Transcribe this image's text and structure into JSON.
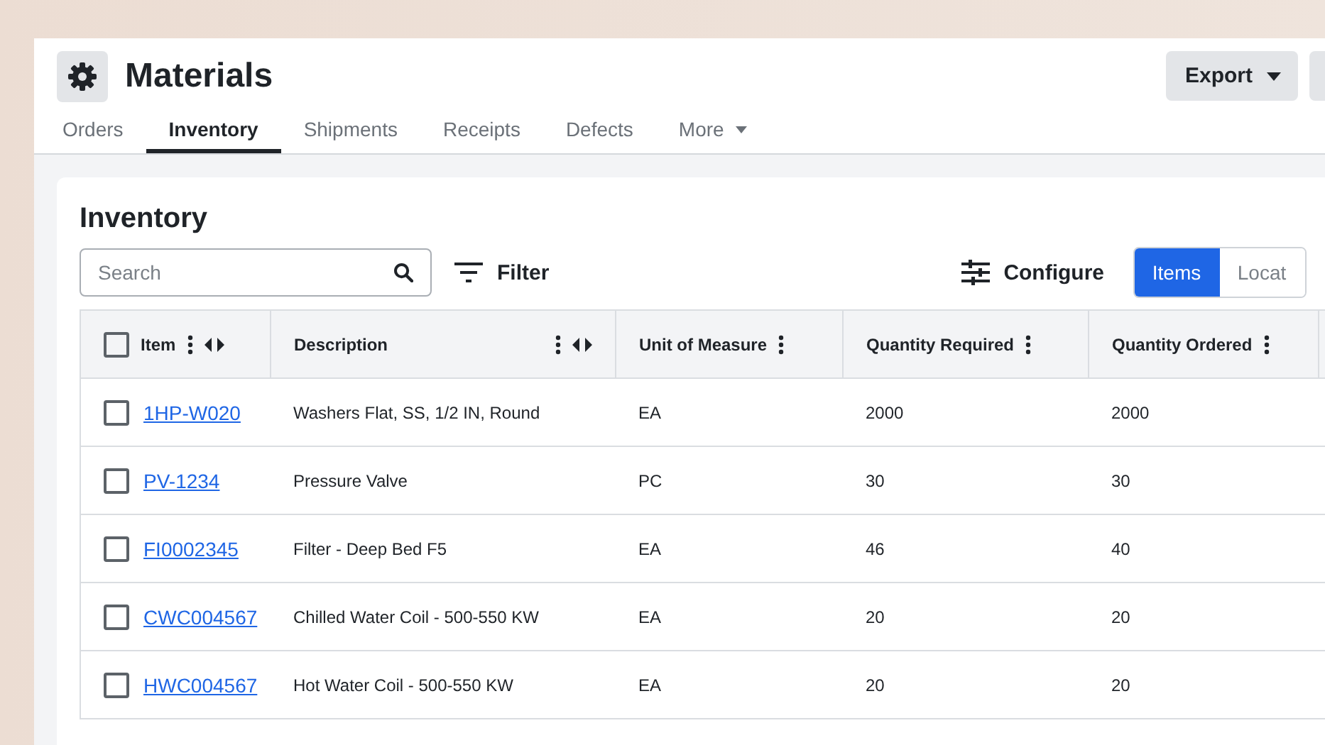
{
  "page": {
    "title": "Materials"
  },
  "header_buttons": [
    {
      "label": "Export",
      "kind": "dropdown"
    },
    {
      "kind": "cut"
    }
  ],
  "tabs": [
    {
      "label": "Orders",
      "selected": false,
      "kind": "tab"
    },
    {
      "label": "Inventory",
      "selected": true,
      "kind": "tab"
    },
    {
      "label": "Shipments",
      "selected": false,
      "kind": "tab"
    },
    {
      "label": "Receipts",
      "selected": false,
      "kind": "tab"
    },
    {
      "label": "Defects",
      "selected": false,
      "kind": "tab"
    },
    {
      "label": "More",
      "selected": false,
      "kind": "menu"
    }
  ],
  "card": {
    "title": "Inventory",
    "search": {
      "placeholder": "Search"
    },
    "filter_button": "Filter",
    "configure_button": "Configure",
    "views": [
      {
        "label": "Items",
        "selected": true
      },
      {
        "label": "Locat",
        "selected": false
      }
    ],
    "table": {
      "header_checked": false,
      "columns": [
        {
          "label": "Item",
          "menu": true,
          "resize": true
        },
        {
          "label": "Description",
          "menu": true,
          "resize": true
        },
        {
          "label": "Unit of Measure",
          "menu": true,
          "resize": false
        },
        {
          "label": "Quantity Required",
          "menu": true,
          "resize": false
        },
        {
          "label": "Quantity Ordered",
          "menu": true,
          "resize": false
        }
      ],
      "rows": [
        {
          "checked": false,
          "cells": [
            "1HP-W020",
            "Washers Flat, SS, 1/2 IN, Round",
            "EA",
            "2000",
            "2000"
          ]
        },
        {
          "checked": false,
          "cells": [
            "PV-1234",
            "Pressure Valve",
            "PC",
            "30",
            "30"
          ]
        },
        {
          "checked": false,
          "cells": [
            "FI0002345",
            "Filter - Deep Bed F5",
            "EA",
            "46",
            "40"
          ]
        },
        {
          "checked": false,
          "cells": [
            "CWC004567",
            "Chilled Water Coil - 500-550 KW",
            "EA",
            "20",
            "20"
          ]
        },
        {
          "checked": false,
          "cells": [
            "HWC004567",
            "Hot Water Coil - 500-550 KW",
            "EA",
            "20",
            "20"
          ]
        }
      ]
    }
  }
}
